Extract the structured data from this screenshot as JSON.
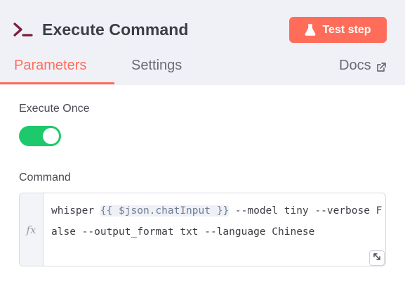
{
  "node": {
    "title": "Execute Command",
    "icon": "terminal-icon"
  },
  "test_button": {
    "label": "Test step",
    "icon": "flask-icon",
    "color": "#ff6d5a"
  },
  "tabs": [
    {
      "label": "Parameters",
      "active": true
    },
    {
      "label": "Settings",
      "active": false
    },
    {
      "label": "Docs",
      "active": false,
      "icon": "external-link-icon"
    }
  ],
  "execute_once": {
    "label": "Execute Once",
    "enabled": true,
    "color": "#1ec96b"
  },
  "command": {
    "label": "Command",
    "prefix": "whisper ",
    "expression": "{{ $json.chatInput }}",
    "suffix": " --model tiny --verbose False --output_format txt --language Chinese",
    "gutter_label": "fx",
    "expand_icon": "expand-icon"
  }
}
